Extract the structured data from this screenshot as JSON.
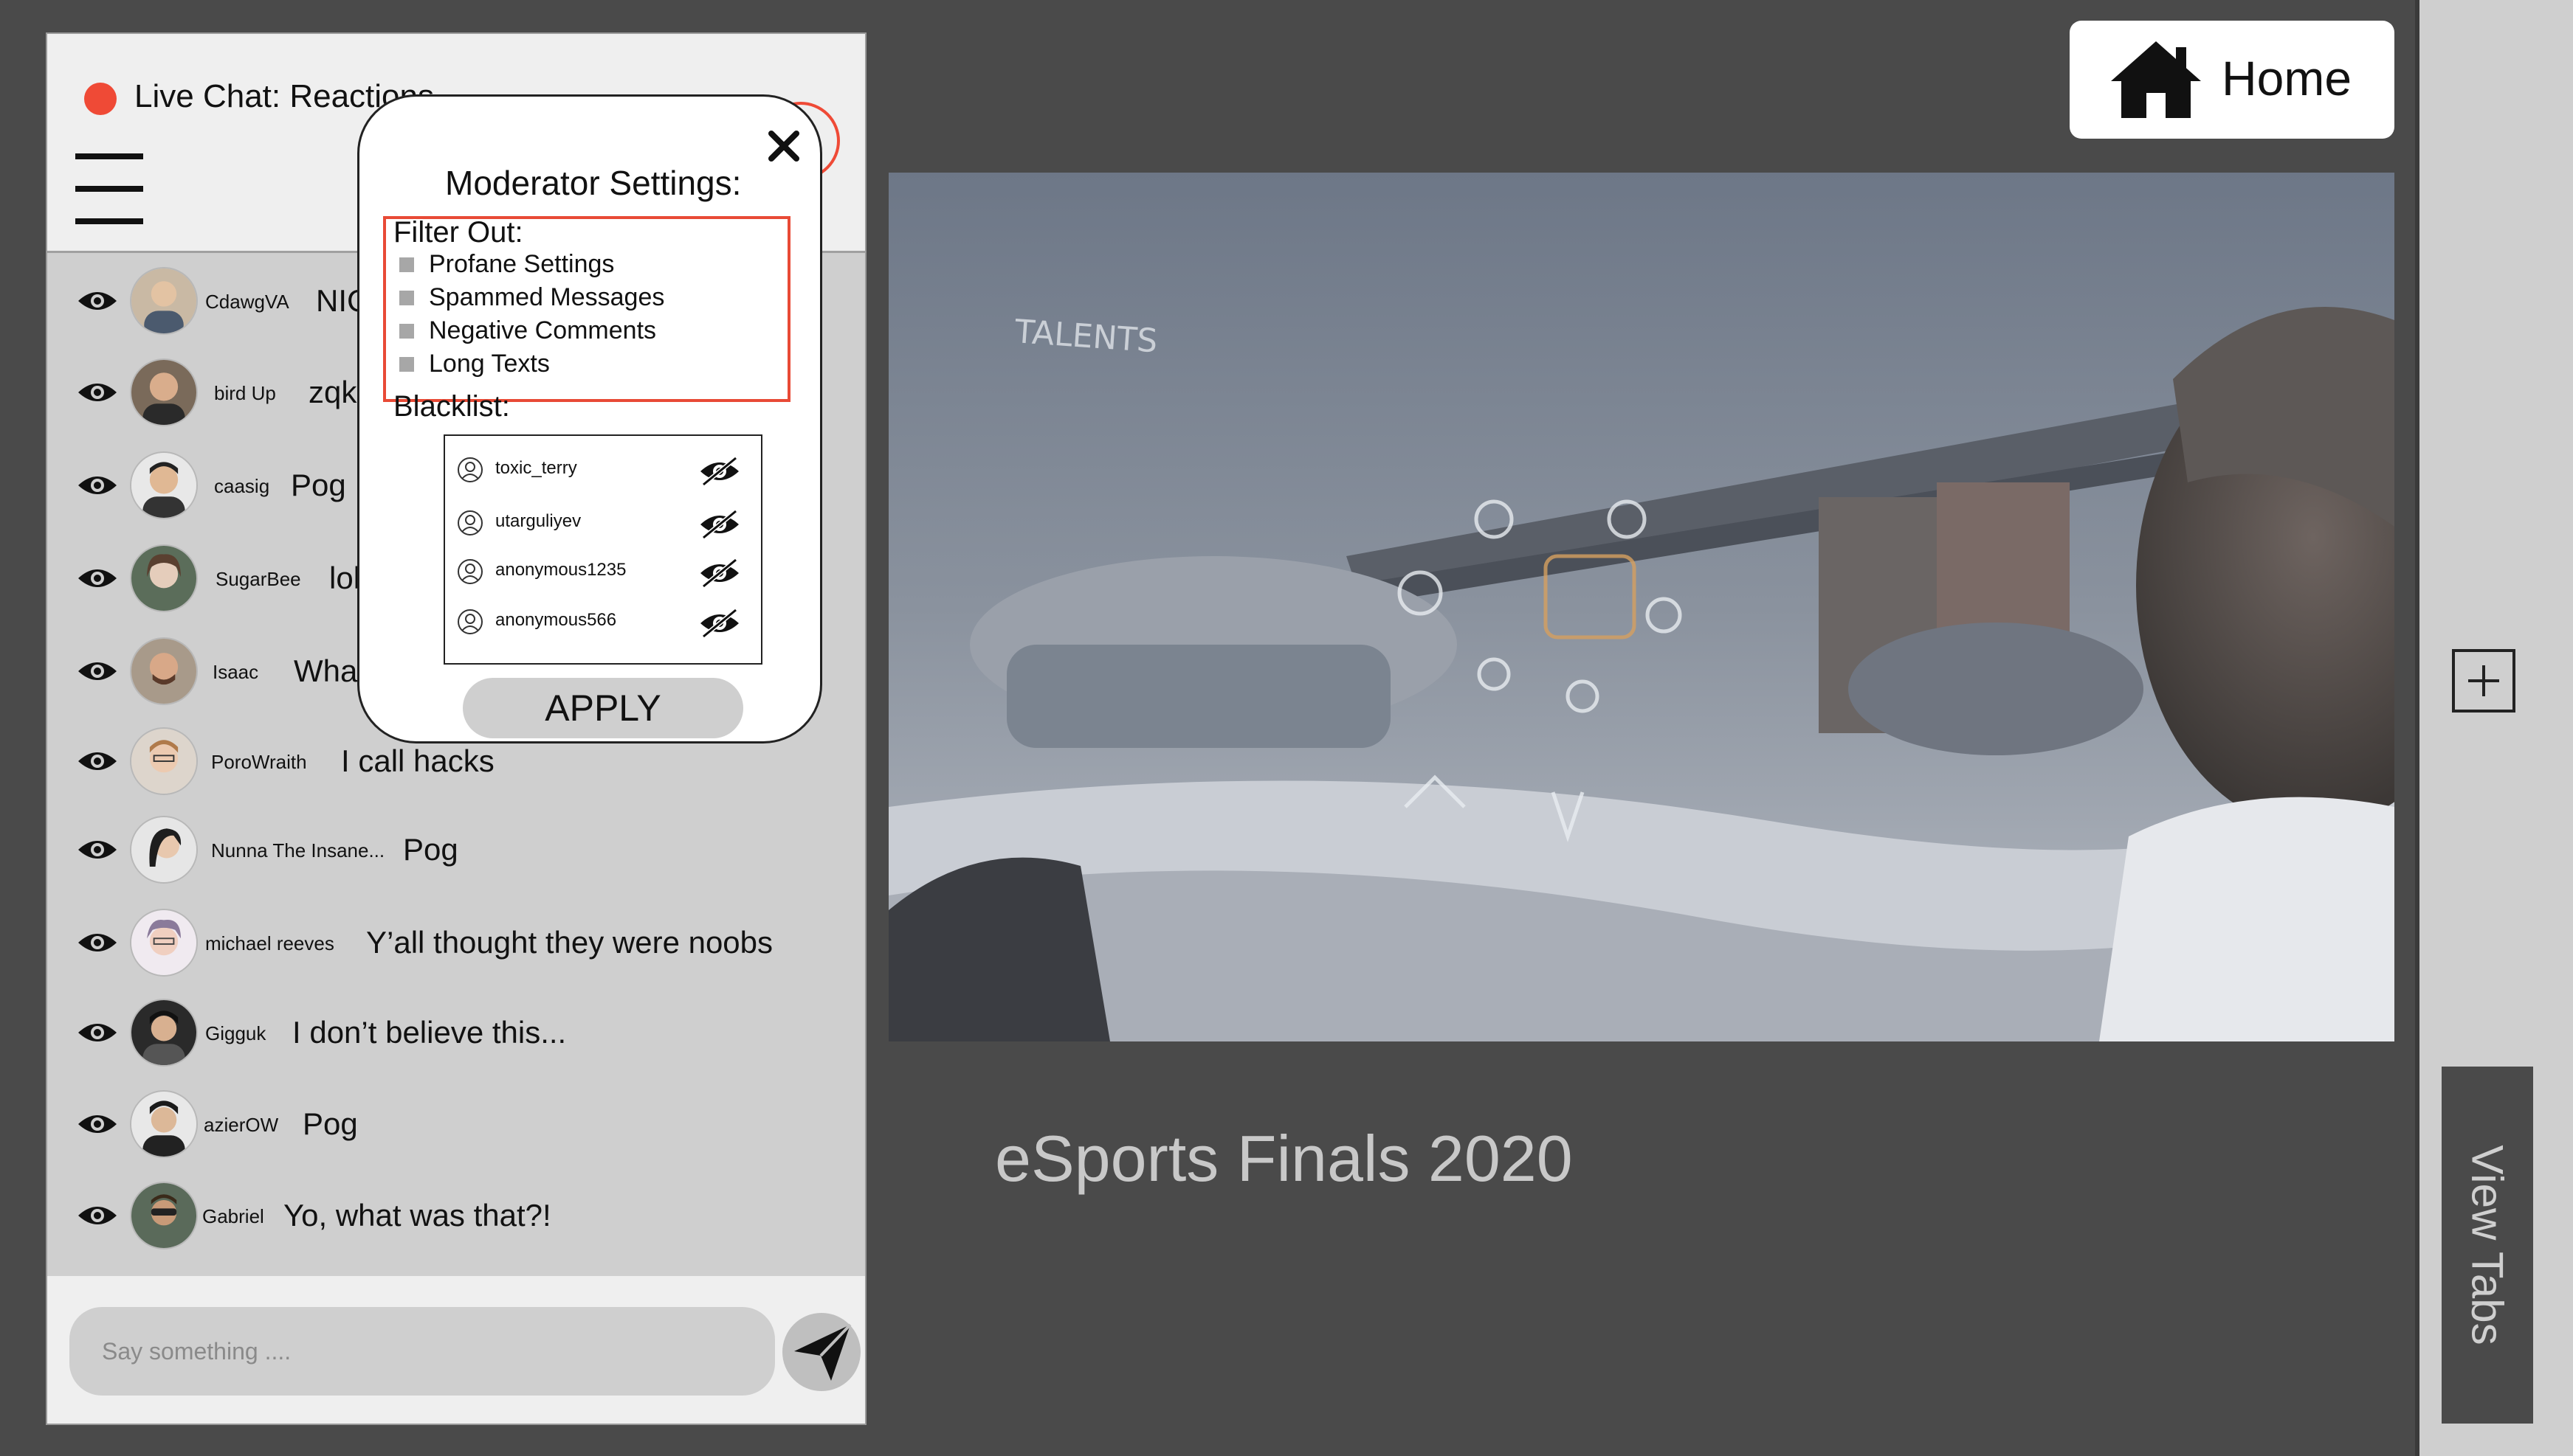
{
  "chat": {
    "title": "Live Chat: Reactions",
    "input_placeholder": "Say something ....",
    "messages": [
      {
        "user": "CdawgVA",
        "text": "NICE"
      },
      {
        "user": "bird Up",
        "text": "zqk"
      },
      {
        "user": "caasig",
        "text": "Pog"
      },
      {
        "user": "SugarBee",
        "text": "lol"
      },
      {
        "user": "Isaac",
        "text": "What"
      },
      {
        "user": "PoroWraith",
        "text": "I call hacks"
      },
      {
        "user": "Nunna The Insane...",
        "text": "Pog"
      },
      {
        "user": "michael reeves",
        "text": "Y’all thought they were noobs"
      },
      {
        "user": "Gigguk",
        "text": "I don’t believe this..."
      },
      {
        "user": "azierOW",
        "text": "Pog"
      },
      {
        "user": "Gabriel",
        "text": "Yo, what was that?!"
      }
    ]
  },
  "moderator": {
    "title": "Moderator Settings:",
    "filter_label": "Filter Out:",
    "filter_options": [
      "Profane Settings",
      "Spammed Messages",
      "Negative Comments",
      "Long Texts"
    ],
    "blacklist_label": "Blacklist:",
    "blacklist": [
      "toxic_terry",
      "utarguliyev",
      "anonymous1235",
      "anonymous566"
    ],
    "apply_label": "APPLY"
  },
  "home": {
    "label": "Home"
  },
  "stream": {
    "title": "eSports Finals 2020"
  },
  "rail": {
    "view_tabs_label": "View Tabs"
  },
  "colors": {
    "accent": "#ef4a36",
    "background": "#4a4a4a",
    "panel": "#cfcfcf"
  },
  "icons": [
    "menu-icon",
    "eye-icon",
    "close-icon",
    "user-icon",
    "hide-icon",
    "send-icon",
    "home-icon",
    "plus-icon"
  ]
}
